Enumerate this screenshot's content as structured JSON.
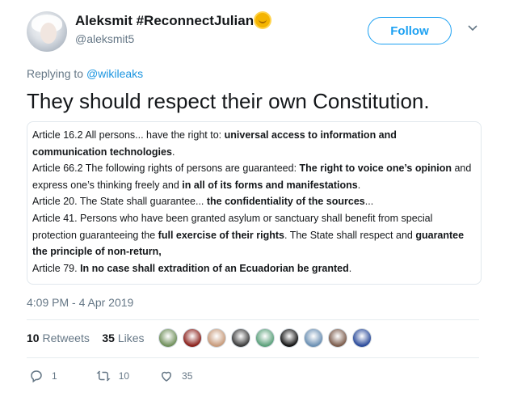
{
  "author": {
    "display_name": "Aleksmit #ReconnectJulian",
    "handle": "@aleksmit5",
    "avatar": "user-avatar",
    "badge_icon": "sun-emoji-icon"
  },
  "header": {
    "follow_label": "Follow",
    "menu_icon": "chevron-down-icon"
  },
  "reply": {
    "prefix": "Replying to",
    "mention": "@wikileaks"
  },
  "tweet": {
    "text": "They should respect their own Constitution."
  },
  "quote": {
    "lines": [
      [
        {
          "t": "Article 16.2 All persons... have the right to: ",
          "b": false
        },
        {
          "t": "universal access to information and",
          "b": true
        }
      ],
      [
        {
          "t": "communication technologies",
          "b": true
        },
        {
          "t": ".",
          "b": false
        }
      ],
      [
        {
          "t": "Article 66.2 The following rights of persons are guaranteed: ",
          "b": false
        },
        {
          "t": "The right to voice one’s opinion",
          "b": true
        },
        {
          "t": " and",
          "b": false
        }
      ],
      [
        {
          "t": "express one’s thinking freely and ",
          "b": false
        },
        {
          "t": "in all of its forms and manifestations",
          "b": true
        },
        {
          "t": ".",
          "b": false
        }
      ],
      [
        {
          "t": "Article 20. The State shall guarantee... ",
          "b": false
        },
        {
          "t": "the confidentiality of the sources",
          "b": true
        },
        {
          "t": "...",
          "b": false
        }
      ],
      [
        {
          "t": "Article 41. Persons who have been granted asylum or sanctuary shall benefit from special",
          "b": false
        }
      ],
      [
        {
          "t": "protection guaranteeing the ",
          "b": false
        },
        {
          "t": "full exercise of their rights",
          "b": true
        },
        {
          "t": ". The State shall respect and ",
          "b": false
        },
        {
          "t": "guarantee",
          "b": true
        }
      ],
      [
        {
          "t": "the principle of non-return,",
          "b": true
        }
      ],
      [
        {
          "t": "Article 79. ",
          "b": false
        },
        {
          "t": "In no case shall extradition of an Ecuadorian be granted",
          "b": true
        },
        {
          "t": ".",
          "b": false
        }
      ]
    ]
  },
  "timestamp": "4:09 PM - 4 Apr 2019",
  "stats": {
    "retweets_count": "10",
    "retweets_label": "Retweets",
    "likes_count": "35",
    "likes_label": "Likes"
  },
  "likers": [
    {
      "name": "liker-avatar-1",
      "color": "#6f8f5a"
    },
    {
      "name": "liker-avatar-2",
      "color": "#8a1f1a"
    },
    {
      "name": "liker-avatar-3",
      "color": "#c79a7a"
    },
    {
      "name": "liker-avatar-4",
      "color": "#3a3a3a"
    },
    {
      "name": "liker-avatar-5",
      "color": "#5aa07a"
    },
    {
      "name": "liker-avatar-6",
      "color": "#111111"
    },
    {
      "name": "liker-avatar-7",
      "color": "#6a8fb3"
    },
    {
      "name": "liker-avatar-8",
      "color": "#7a5a4a"
    },
    {
      "name": "liker-avatar-9-uk-flag",
      "color": "#2a4a9a"
    }
  ],
  "actions": {
    "reply_count": "1",
    "retweet_count": "10",
    "like_count": "35"
  },
  "colors": {
    "accent": "#1da1f2",
    "link": "#1b95e0",
    "muted": "#657786",
    "text": "#14171a",
    "border": "#e1e8ed"
  }
}
